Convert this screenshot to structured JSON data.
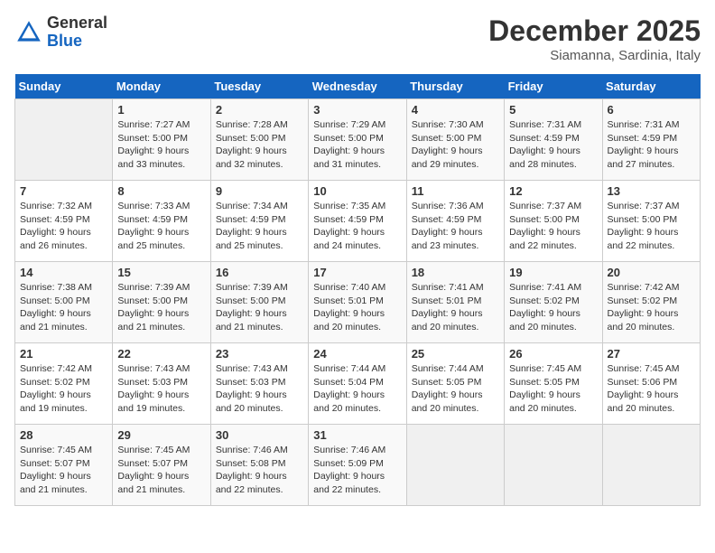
{
  "header": {
    "logo": {
      "general": "General",
      "blue": "Blue"
    },
    "title": "December 2025",
    "subtitle": "Siamanna, Sardinia, Italy"
  },
  "weekdays": [
    "Sunday",
    "Monday",
    "Tuesday",
    "Wednesday",
    "Thursday",
    "Friday",
    "Saturday"
  ],
  "weeks": [
    [
      {
        "day": "",
        "empty": true
      },
      {
        "day": "1",
        "sunrise": "Sunrise: 7:27 AM",
        "sunset": "Sunset: 5:00 PM",
        "daylight": "Daylight: 9 hours and 33 minutes."
      },
      {
        "day": "2",
        "sunrise": "Sunrise: 7:28 AM",
        "sunset": "Sunset: 5:00 PM",
        "daylight": "Daylight: 9 hours and 32 minutes."
      },
      {
        "day": "3",
        "sunrise": "Sunrise: 7:29 AM",
        "sunset": "Sunset: 5:00 PM",
        "daylight": "Daylight: 9 hours and 31 minutes."
      },
      {
        "day": "4",
        "sunrise": "Sunrise: 7:30 AM",
        "sunset": "Sunset: 5:00 PM",
        "daylight": "Daylight: 9 hours and 29 minutes."
      },
      {
        "day": "5",
        "sunrise": "Sunrise: 7:31 AM",
        "sunset": "Sunset: 4:59 PM",
        "daylight": "Daylight: 9 hours and 28 minutes."
      },
      {
        "day": "6",
        "sunrise": "Sunrise: 7:31 AM",
        "sunset": "Sunset: 4:59 PM",
        "daylight": "Daylight: 9 hours and 27 minutes."
      }
    ],
    [
      {
        "day": "7",
        "sunrise": "Sunrise: 7:32 AM",
        "sunset": "Sunset: 4:59 PM",
        "daylight": "Daylight: 9 hours and 26 minutes."
      },
      {
        "day": "8",
        "sunrise": "Sunrise: 7:33 AM",
        "sunset": "Sunset: 4:59 PM",
        "daylight": "Daylight: 9 hours and 25 minutes."
      },
      {
        "day": "9",
        "sunrise": "Sunrise: 7:34 AM",
        "sunset": "Sunset: 4:59 PM",
        "daylight": "Daylight: 9 hours and 25 minutes."
      },
      {
        "day": "10",
        "sunrise": "Sunrise: 7:35 AM",
        "sunset": "Sunset: 4:59 PM",
        "daylight": "Daylight: 9 hours and 24 minutes."
      },
      {
        "day": "11",
        "sunrise": "Sunrise: 7:36 AM",
        "sunset": "Sunset: 4:59 PM",
        "daylight": "Daylight: 9 hours and 23 minutes."
      },
      {
        "day": "12",
        "sunrise": "Sunrise: 7:37 AM",
        "sunset": "Sunset: 5:00 PM",
        "daylight": "Daylight: 9 hours and 22 minutes."
      },
      {
        "day": "13",
        "sunrise": "Sunrise: 7:37 AM",
        "sunset": "Sunset: 5:00 PM",
        "daylight": "Daylight: 9 hours and 22 minutes."
      }
    ],
    [
      {
        "day": "14",
        "sunrise": "Sunrise: 7:38 AM",
        "sunset": "Sunset: 5:00 PM",
        "daylight": "Daylight: 9 hours and 21 minutes."
      },
      {
        "day": "15",
        "sunrise": "Sunrise: 7:39 AM",
        "sunset": "Sunset: 5:00 PM",
        "daylight": "Daylight: 9 hours and 21 minutes."
      },
      {
        "day": "16",
        "sunrise": "Sunrise: 7:39 AM",
        "sunset": "Sunset: 5:00 PM",
        "daylight": "Daylight: 9 hours and 21 minutes."
      },
      {
        "day": "17",
        "sunrise": "Sunrise: 7:40 AM",
        "sunset": "Sunset: 5:01 PM",
        "daylight": "Daylight: 9 hours and 20 minutes."
      },
      {
        "day": "18",
        "sunrise": "Sunrise: 7:41 AM",
        "sunset": "Sunset: 5:01 PM",
        "daylight": "Daylight: 9 hours and 20 minutes."
      },
      {
        "day": "19",
        "sunrise": "Sunrise: 7:41 AM",
        "sunset": "Sunset: 5:02 PM",
        "daylight": "Daylight: 9 hours and 20 minutes."
      },
      {
        "day": "20",
        "sunrise": "Sunrise: 7:42 AM",
        "sunset": "Sunset: 5:02 PM",
        "daylight": "Daylight: 9 hours and 20 minutes."
      }
    ],
    [
      {
        "day": "21",
        "sunrise": "Sunrise: 7:42 AM",
        "sunset": "Sunset: 5:02 PM",
        "daylight": "Daylight: 9 hours and 19 minutes."
      },
      {
        "day": "22",
        "sunrise": "Sunrise: 7:43 AM",
        "sunset": "Sunset: 5:03 PM",
        "daylight": "Daylight: 9 hours and 19 minutes."
      },
      {
        "day": "23",
        "sunrise": "Sunrise: 7:43 AM",
        "sunset": "Sunset: 5:03 PM",
        "daylight": "Daylight: 9 hours and 20 minutes."
      },
      {
        "day": "24",
        "sunrise": "Sunrise: 7:44 AM",
        "sunset": "Sunset: 5:04 PM",
        "daylight": "Daylight: 9 hours and 20 minutes."
      },
      {
        "day": "25",
        "sunrise": "Sunrise: 7:44 AM",
        "sunset": "Sunset: 5:05 PM",
        "daylight": "Daylight: 9 hours and 20 minutes."
      },
      {
        "day": "26",
        "sunrise": "Sunrise: 7:45 AM",
        "sunset": "Sunset: 5:05 PM",
        "daylight": "Daylight: 9 hours and 20 minutes."
      },
      {
        "day": "27",
        "sunrise": "Sunrise: 7:45 AM",
        "sunset": "Sunset: 5:06 PM",
        "daylight": "Daylight: 9 hours and 20 minutes."
      }
    ],
    [
      {
        "day": "28",
        "sunrise": "Sunrise: 7:45 AM",
        "sunset": "Sunset: 5:07 PM",
        "daylight": "Daylight: 9 hours and 21 minutes."
      },
      {
        "day": "29",
        "sunrise": "Sunrise: 7:45 AM",
        "sunset": "Sunset: 5:07 PM",
        "daylight": "Daylight: 9 hours and 21 minutes."
      },
      {
        "day": "30",
        "sunrise": "Sunrise: 7:46 AM",
        "sunset": "Sunset: 5:08 PM",
        "daylight": "Daylight: 9 hours and 22 minutes."
      },
      {
        "day": "31",
        "sunrise": "Sunrise: 7:46 AM",
        "sunset": "Sunset: 5:09 PM",
        "daylight": "Daylight: 9 hours and 22 minutes."
      },
      {
        "day": "",
        "empty": true
      },
      {
        "day": "",
        "empty": true
      },
      {
        "day": "",
        "empty": true
      }
    ]
  ]
}
